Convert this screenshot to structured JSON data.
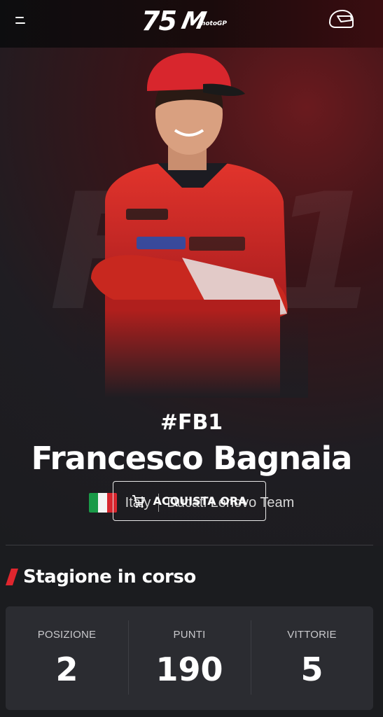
{
  "header": {
    "logo": {
      "number": "75",
      "brand_mark": "M",
      "brand_name": "motoGP"
    },
    "menu_icon": "hamburger-menu-icon",
    "helmet_icon": "helmet-icon"
  },
  "hero": {
    "background_number": "FB1",
    "rider_tag": "#FB1",
    "rider_name": "Francesco Bagnaia",
    "country": "Italy",
    "team": "Ducati Lenovo Team",
    "buy_button_label": "ACQUISTA ORA",
    "cart_icon": "shopping-cart-icon"
  },
  "season": {
    "title": "Stagione in corso",
    "stats": [
      {
        "label": "POSIZIONE",
        "value": "2"
      },
      {
        "label": "PUNTI",
        "value": "190"
      },
      {
        "label": "VITTORIE",
        "value": "5"
      }
    ]
  },
  "colors": {
    "accent_red": "#e0262e",
    "background": "#1b1c1f",
    "card": "#2b2c31"
  }
}
